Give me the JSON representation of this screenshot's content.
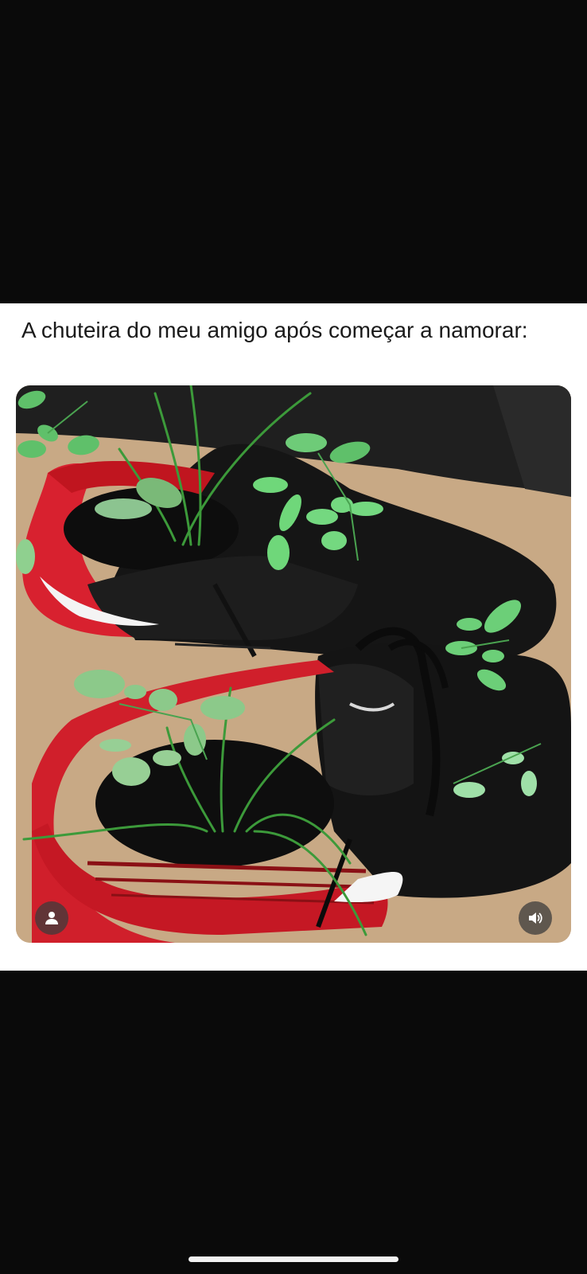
{
  "post": {
    "caption": "A chuteira do meu amigo após começar a namorar:"
  },
  "media": {
    "avatar_icon": "person-icon",
    "sound_icon": "speaker-sound-icon"
  },
  "colors": {
    "background": "#0a0a0a",
    "card": "#ffffff",
    "text": "#1a1a1a",
    "overlay_button": "#3c3c3c"
  }
}
